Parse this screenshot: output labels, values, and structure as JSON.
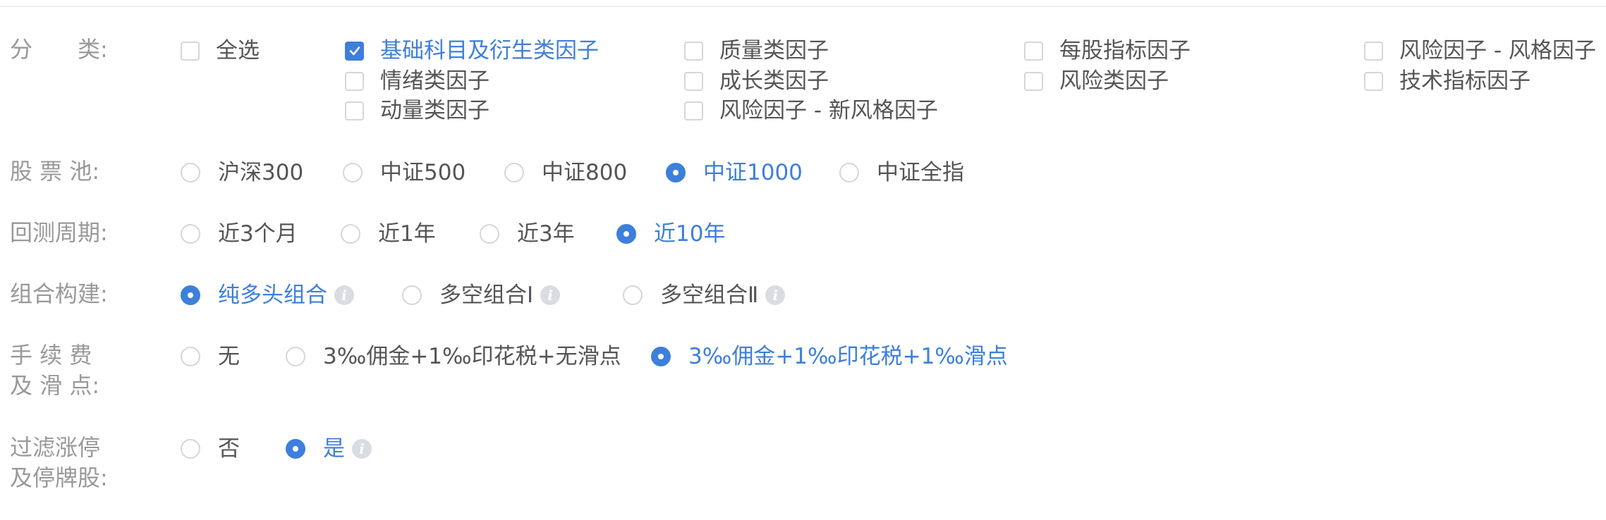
{
  "colors": {
    "accent": "#3d7fdb",
    "label": "#999999",
    "text": "#555555",
    "border": "#d6d6d6",
    "info_icon": "#d9dde3"
  },
  "icons": {
    "checkbox_checked": "check-icon",
    "info": "info-icon"
  },
  "category": {
    "label": "分　　类:",
    "select_all": {
      "label": "全选",
      "checked": false
    },
    "options": [
      {
        "label": "基础科目及衍生类因子",
        "checked": true
      },
      {
        "label": "质量类因子",
        "checked": false
      },
      {
        "label": "每股指标因子",
        "checked": false
      },
      {
        "label": "风险因子 - 风格因子",
        "checked": false
      },
      {
        "label": "情绪类因子",
        "checked": false
      },
      {
        "label": "成长类因子",
        "checked": false
      },
      {
        "label": "风险类因子",
        "checked": false
      },
      {
        "label": "技术指标因子",
        "checked": false
      },
      {
        "label": "动量类因子",
        "checked": false
      },
      {
        "label": "风险因子 - 新风格因子",
        "checked": false
      }
    ]
  },
  "stock_pool": {
    "label": "股 票 池:",
    "selected": "中证1000",
    "options": [
      "沪深300",
      "中证500",
      "中证800",
      "中证1000",
      "中证全指"
    ]
  },
  "backtest_period": {
    "label": "回测周期:",
    "selected": "近10年",
    "options": [
      "近3个月",
      "近1年",
      "近3年",
      "近10年"
    ]
  },
  "portfolio": {
    "label": "组合构建:",
    "selected": "纯多头组合",
    "options": [
      "纯多头组合",
      "多空组合Ⅰ",
      "多空组合Ⅱ"
    ]
  },
  "fees": {
    "label_line1": "手 续 费",
    "label_line2": "及 滑 点:",
    "selected": "3‰佣金+1‰印花税+1‰滑点",
    "options": [
      "无",
      "3‰佣金+1‰印花税+无滑点",
      "3‰佣金+1‰印花税+1‰滑点"
    ]
  },
  "filter": {
    "label_line1": "过滤涨停",
    "label_line2": "及停牌股:",
    "selected": "是",
    "options": [
      "否",
      "是"
    ]
  }
}
